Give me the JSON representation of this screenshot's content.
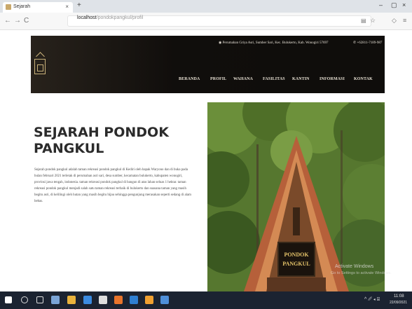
{
  "browser": {
    "tab_title": "Sejarah",
    "tab_close": "×",
    "new_tab": "+",
    "url_domain": "localhost",
    "url_path": "/pondokpangkul/profil",
    "win_min": "–",
    "win_max": "▢",
    "win_close": "×",
    "back": "←",
    "forward": "→",
    "reload": "C"
  },
  "site": {
    "address": "Perumahan Griya Asri, Sumber Sari, Kec. Bulukerto, Kab. Wonogiri 57697",
    "phone": "+62811-7189-987",
    "menu": [
      "BERANDA",
      "PROFIL",
      "WAHANA",
      "FASILITAS",
      "KANTIN",
      "INFORMASI",
      "KONTAK"
    ]
  },
  "content": {
    "title": "SEJARAH PONDOK PANGKUL",
    "paragraph": "Sejarah pondok pangkul adalah taman rekreasi pondok pangkul di Kediri oleh bapak Waryono dan di buka pada bulan februari 2021 terletak di perumahan asri sari, desa sumber, kecamatan bulukerto, kabupaten wonogiri, provinsi jawa tengah, indonesia. taman rekreasi pondok pangkul di bangun di atas lahan seluas 1 hektar. taman rekreasi pondok pangkul menjadi salah satu taman rekreasi terbaik di bulukerto dan suasana taman yang masih begitu asri, di kelilingi oleh hutan yang masih begitu hijau sehingga pengunjung merasakan seperti sedang di alam bebas.",
    "sign_line1": "PONDOK",
    "sign_line2": "PANGKUL",
    "watermark_title": "Activate Windows",
    "watermark_sub": "Go to Settings to activate Windows."
  },
  "taskbar": {
    "time": "11:08",
    "date": "22/09/2021"
  },
  "colors": {
    "header_bg": "#0f0d0b",
    "accent_gold": "#c9b27a",
    "taskbar_bg": "#1b2331"
  }
}
